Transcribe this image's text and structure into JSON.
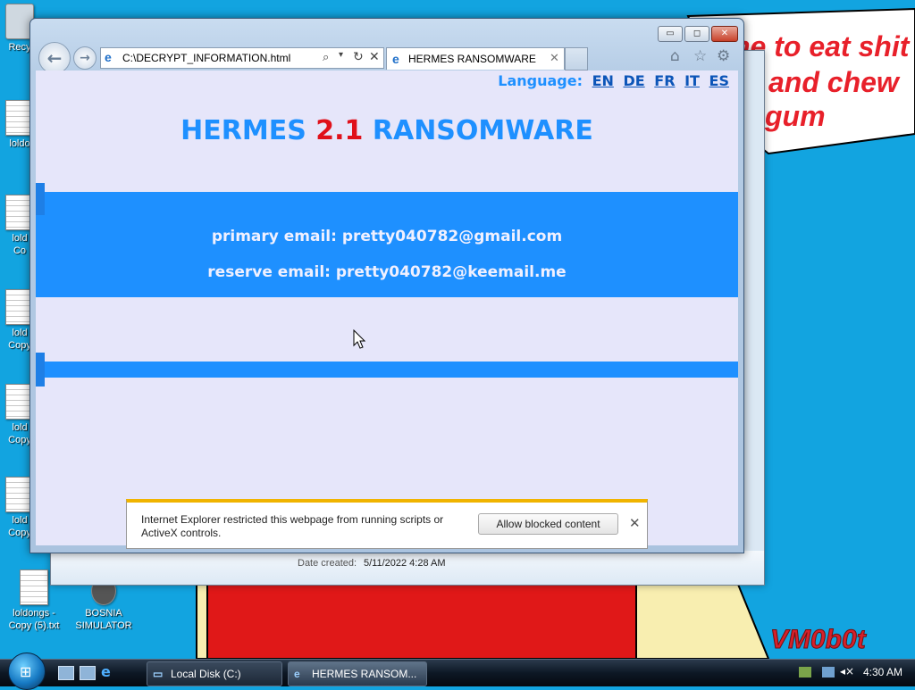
{
  "wallpaper": {
    "text_line_1": "ne to eat shit",
    "text_line_2": "and chew",
    "text_line_3": "gum",
    "signature": "VM0b0t"
  },
  "desktop_icons": {
    "recycle": "Recy",
    "file_1": "loldo",
    "file_2a": "lold",
    "file_2b": "Co",
    "file_3a": "lold",
    "file_3b": "Copy",
    "file_4a": "lold",
    "file_4b": "Copy",
    "file_5a": "lold",
    "file_5b": "Copy",
    "file_6": "loldongs - Copy (5).txt",
    "bosnia": "BOSNIA SIMULATOR"
  },
  "back_window": {
    "date_label": "Date created:",
    "date_value": "5/11/2022 4:28 AM"
  },
  "browser": {
    "address": "C:\\DECRYPT_INFORMATION.html",
    "tab_title": "HERMES RANSOMWARE",
    "controls": {
      "minimize": "▭",
      "maximize": "◻",
      "close": "✕"
    }
  },
  "page": {
    "language_label": "Language:",
    "languages": [
      "EN",
      "DE",
      "FR",
      "IT",
      "ES"
    ],
    "heading_part_1": "HERMES ",
    "heading_version": "2.1",
    "heading_part_2": " RANSOMWARE",
    "primary_email": "primary email: pretty040782@gmail.com",
    "reserve_email": "reserve email: pretty040782@keemail.me"
  },
  "notification": {
    "text": "Internet Explorer restricted this webpage from running scripts or ActiveX controls.",
    "button": "Allow blocked content"
  },
  "taskbar": {
    "task_1": "Local Disk (C:)",
    "task_2": "HERMES RANSOM...",
    "clock": "4:30 AM"
  },
  "colors": {
    "accent_blue": "#1e90ff",
    "version_red": "#e0101a",
    "page_bg": "#e6e6fa"
  }
}
